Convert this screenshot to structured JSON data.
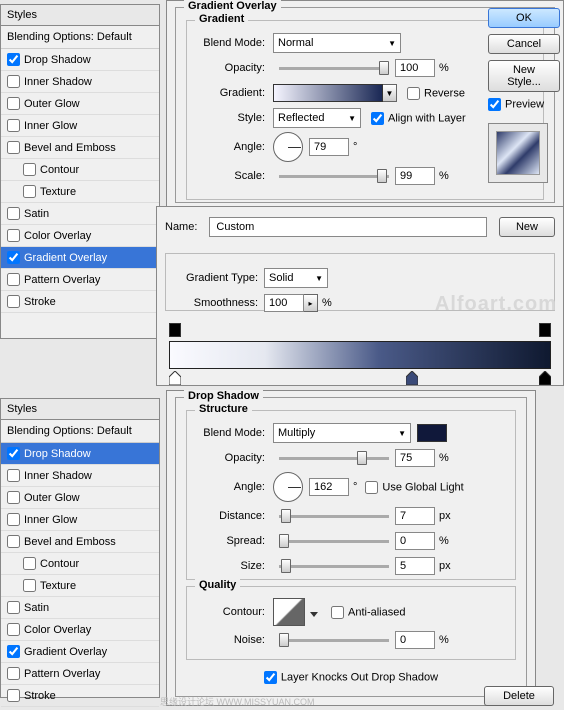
{
  "styles_header": "Styles",
  "blending_default": "Blending Options: Default",
  "style_items": [
    {
      "label": "Drop Shadow",
      "checked": true
    },
    {
      "label": "Inner Shadow",
      "checked": false
    },
    {
      "label": "Outer Glow",
      "checked": false
    },
    {
      "label": "Inner Glow",
      "checked": false
    },
    {
      "label": "Bevel and Emboss",
      "checked": false
    },
    {
      "label": "Contour",
      "checked": false,
      "sub": true
    },
    {
      "label": "Texture",
      "checked": false,
      "sub": true
    },
    {
      "label": "Satin",
      "checked": false
    },
    {
      "label": "Color Overlay",
      "checked": false
    },
    {
      "label": "Gradient Overlay",
      "checked": true
    },
    {
      "label": "Pattern Overlay",
      "checked": false
    },
    {
      "label": "Stroke",
      "checked": false
    }
  ],
  "gradient_overlay": {
    "title": "Gradient Overlay",
    "sub": "Gradient",
    "blend_mode_label": "Blend Mode:",
    "blend_mode": "Normal",
    "opacity_label": "Opacity:",
    "opacity": "100",
    "opacity_unit": "%",
    "gradient_label": "Gradient:",
    "reverse_label": "Reverse",
    "style_label": "Style:",
    "style": "Reflected",
    "align_label": "Align with Layer",
    "angle_label": "Angle:",
    "angle": "79",
    "angle_unit": "°",
    "scale_label": "Scale:",
    "scale": "99",
    "scale_unit": "%"
  },
  "buttons": {
    "ok": "OK",
    "cancel": "Cancel",
    "new_style": "New Style...",
    "preview": "Preview"
  },
  "grad_editor": {
    "name_label": "Name:",
    "name": "Custom",
    "new": "New",
    "type_label": "Gradient Type:",
    "type": "Solid",
    "smooth_label": "Smoothness:",
    "smooth": "100",
    "smooth_unit": "%"
  },
  "watermark": "Alfoart.com",
  "drop_shadow": {
    "title": "Drop Shadow",
    "structure": "Structure",
    "blend_mode_label": "Blend Mode:",
    "blend_mode": "Multiply",
    "opacity_label": "Opacity:",
    "opacity": "75",
    "opacity_unit": "%",
    "angle_label": "Angle:",
    "angle": "162",
    "angle_unit": "°",
    "global_label": "Use Global Light",
    "distance_label": "Distance:",
    "distance": "7",
    "distance_unit": "px",
    "spread_label": "Spread:",
    "spread": "0",
    "spread_unit": "%",
    "size_label": "Size:",
    "size": "5",
    "size_unit": "px",
    "quality": "Quality",
    "contour_label": "Contour:",
    "anti_label": "Anti-aliased",
    "noise_label": "Noise:",
    "noise": "0",
    "noise_unit": "%",
    "knockout": "Layer Knocks Out Drop Shadow"
  },
  "delete": "Delete",
  "footer_watermark": "思缘设计论坛   WWW.MISSYUAN.COM"
}
